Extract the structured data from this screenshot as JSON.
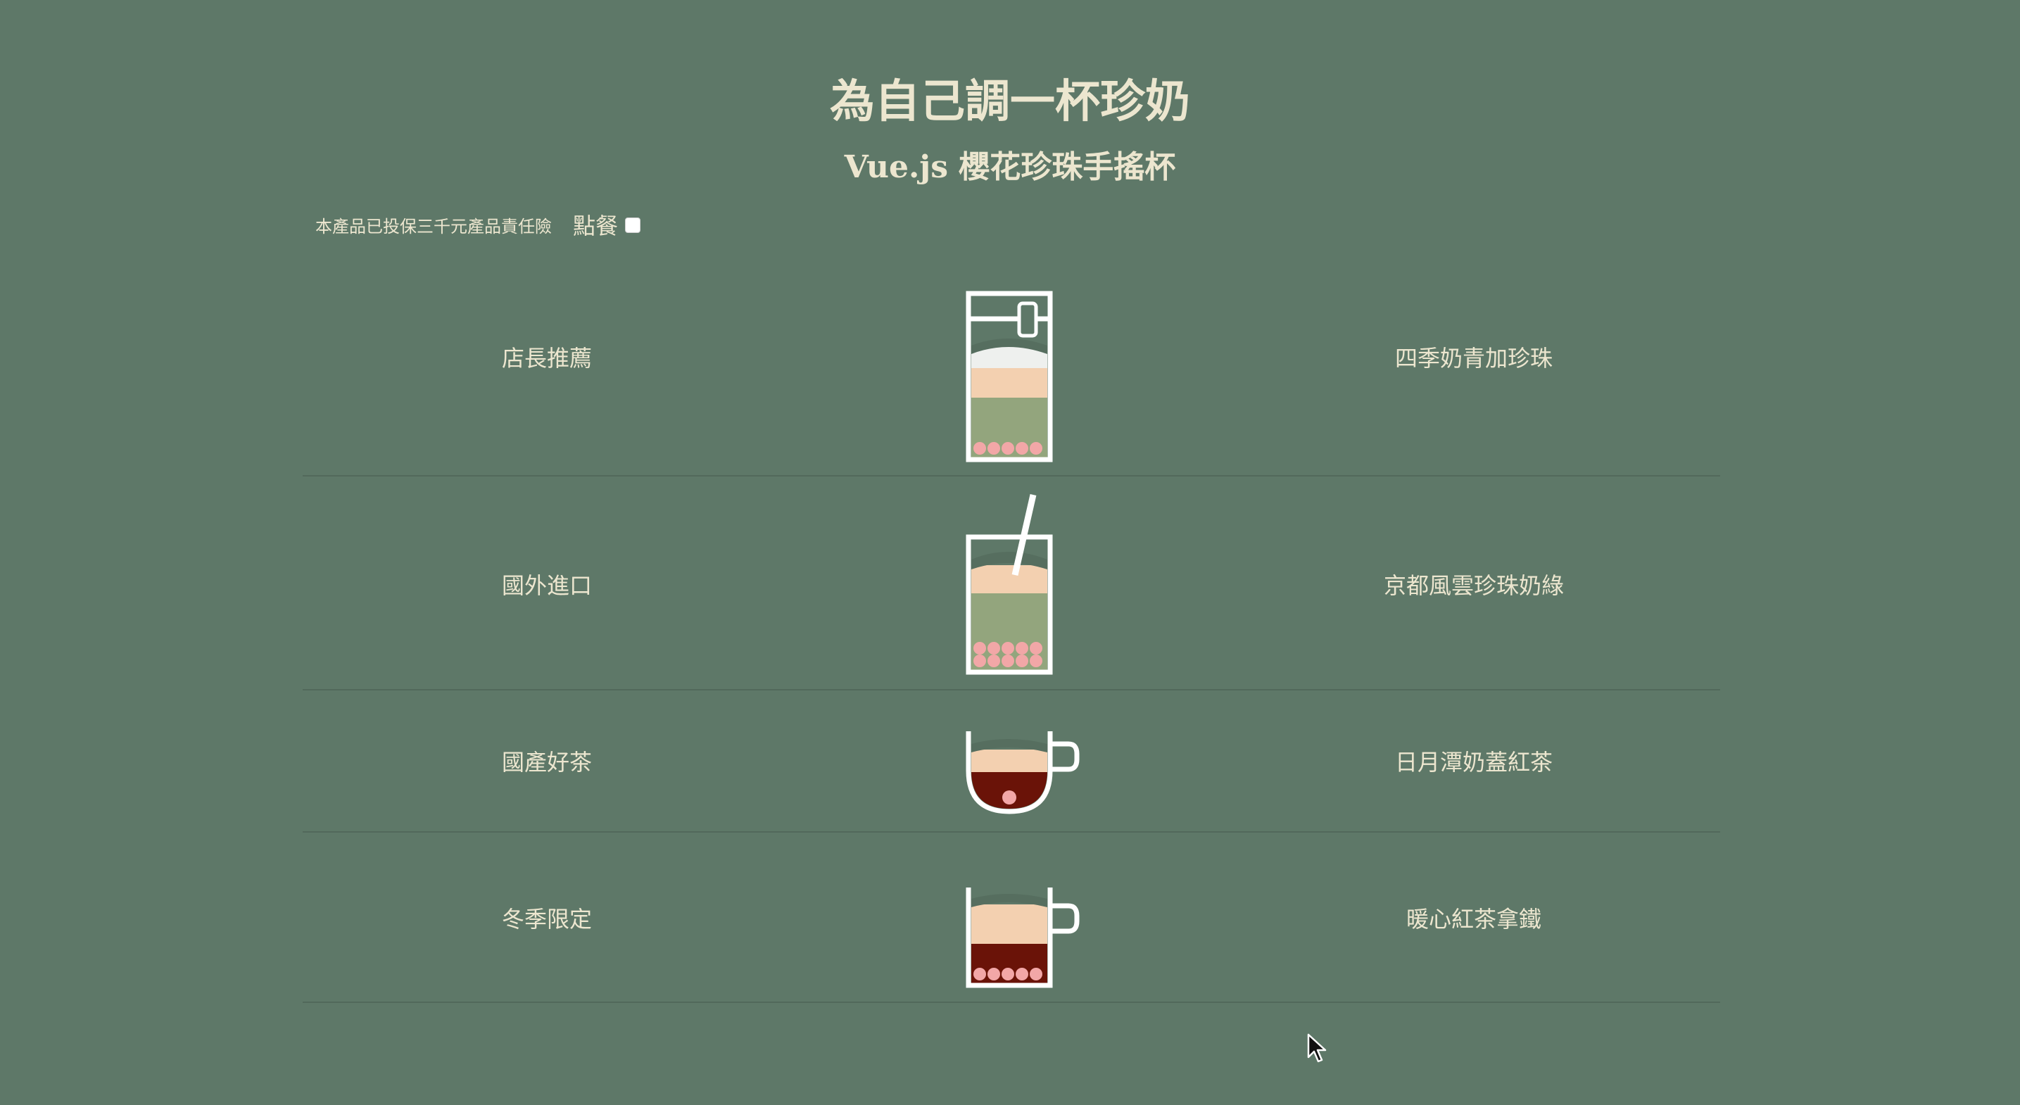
{
  "header": {
    "title": "為自己調一杯珍奶",
    "subtitle": "Vue.js 櫻花珍珠手搖杯"
  },
  "order_bar": {
    "insurance_text": "本產品已投保三千元產品責任險",
    "order_label": "點餐",
    "order_checked": false
  },
  "menu": [
    {
      "category": "店長推薦",
      "drink": "四季奶青加珍珠",
      "cup": "sealed-cup"
    },
    {
      "category": "國外進口",
      "drink": "京都風雲珍珠奶綠",
      "cup": "cup-with-straw"
    },
    {
      "category": "國產好茶",
      "drink": "日月潭奶蓋紅茶",
      "cup": "bowl-mug"
    },
    {
      "category": "冬季限定",
      "drink": "暖心紅茶拿鐵",
      "cup": "mug"
    }
  ],
  "colors": {
    "background": "#5e7868",
    "text": "#ece6cf",
    "cup_outline": "#ffffff",
    "foam_cream": "#f3d0b0",
    "green_tea": "#93a57d",
    "black_tea": "#6a1308",
    "pearls": "#f2a7a7"
  }
}
